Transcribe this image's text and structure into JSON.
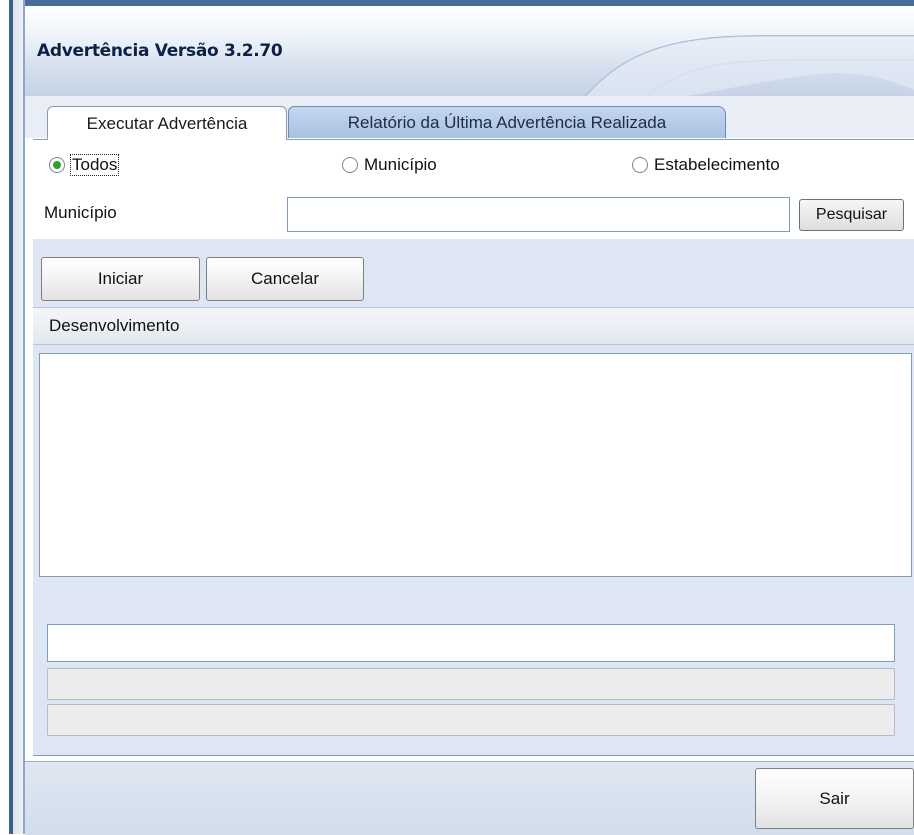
{
  "window": {
    "title": "Advertência Versão 3.2.70"
  },
  "tabs": [
    {
      "label": "Executar Advertência",
      "active": true
    },
    {
      "label": "Relatório da Última Advertência Realizada",
      "active": false
    }
  ],
  "filter": {
    "options": [
      {
        "label": "Todos",
        "selected": true
      },
      {
        "label": "Município",
        "selected": false
      },
      {
        "label": "Estabelecimento",
        "selected": false
      }
    ],
    "municipio_label": "Município",
    "municipio_value": "",
    "search_label": "Pesquisar"
  },
  "actions": {
    "start_label": "Iniciar",
    "cancel_label": "Cancelar"
  },
  "progress_section": {
    "header": "Desenvolvimento",
    "status_text": "",
    "progress1": 0,
    "progress2": 0
  },
  "footer": {
    "exit_label": "Sair"
  },
  "colors": {
    "accent": "#2aa52a",
    "tab_active_bg": "#ffffff",
    "tab_inactive_bg": "#b8cce8",
    "panel_bg": "#dde6f2"
  }
}
